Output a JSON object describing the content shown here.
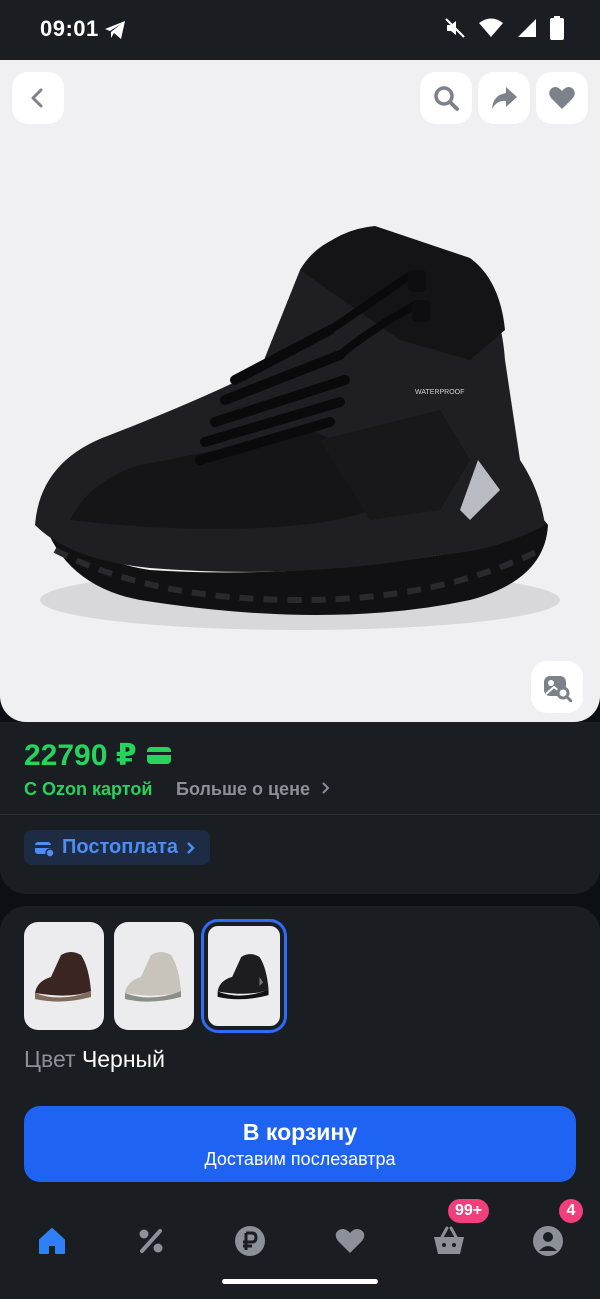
{
  "status_bar": {
    "time": "09:01",
    "icons": [
      "telegram-icon",
      "mute-icon",
      "wifi-icon",
      "signal-icon",
      "battery-icon"
    ]
  },
  "gallery": {
    "buttons": [
      "back-icon",
      "search-icon",
      "share-icon",
      "favorite-icon"
    ],
    "image_label": "WATERPROOF",
    "search_by_photo_icon": "image-search-icon"
  },
  "price": {
    "value": "22790 ₽",
    "card_price_label": "С Ozon картой",
    "more_price_link": "Больше о цене",
    "postpay_label": "Постоплата"
  },
  "variants": {
    "swatches": [
      {
        "color": "#3b2520",
        "accent": "#7e6b5b"
      },
      {
        "color": "#c8c4bc",
        "accent": "#8a8f88"
      },
      {
        "color": "#1d1d1f",
        "accent": "#777777"
      }
    ],
    "selected_index": 2,
    "color_label": "Цвет",
    "color_value": "Черный"
  },
  "cart_button": {
    "title": "В корзину",
    "subtitle": "Доставим послезавтра"
  },
  "bottom_nav": {
    "items": [
      "home-icon",
      "percent-icon",
      "ruble-icon",
      "heart-icon",
      "basket-icon",
      "profile-icon"
    ],
    "cart_badge": "99+",
    "profile_badge": "4"
  },
  "colors": {
    "accent_green": "#27d35d",
    "accent_blue": "#1f63f2",
    "badge_pink": "#f03f7a"
  }
}
